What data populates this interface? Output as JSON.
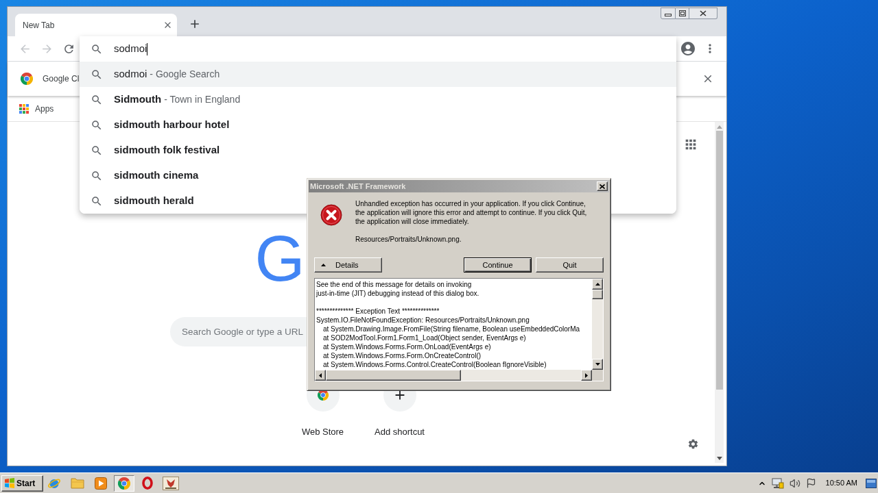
{
  "browser": {
    "tabs": [
      {
        "label": "New Tab",
        "selected": true
      }
    ],
    "nav_buttons": [
      {
        "kind": "back",
        "disabled": true
      },
      {
        "kind": "forward",
        "disabled": true
      },
      {
        "kind": "reload",
        "disabled": false
      }
    ],
    "omnibox": {
      "value": "sodmoi",
      "suggestions": [
        {
          "kind": "typed",
          "text": "sodmoi",
          "detail": "- Google Search",
          "selected": true
        },
        {
          "kind": "entity",
          "text": "Sidmouth",
          "detail": "- Town in England",
          "selected": false
        },
        {
          "kind": "query",
          "text": "sidmouth harbour hotel",
          "selected": false
        },
        {
          "kind": "query",
          "text": "sidmouth folk festival",
          "selected": false
        },
        {
          "kind": "query",
          "text": "sidmouth cinema",
          "selected": false
        },
        {
          "kind": "query",
          "text": "sidmouth herald",
          "selected": false
        }
      ]
    },
    "infobar": {
      "text": "Google Cl"
    },
    "bookmarks": [
      {
        "label": "Apps"
      }
    ],
    "new_tab_page": {
      "logo": "G",
      "search_placeholder": "Search Google or type a URL",
      "shortcuts": [
        {
          "kind": "store",
          "label": "Web Store"
        },
        {
          "kind": "add",
          "label": "Add shortcut"
        }
      ]
    }
  },
  "dialog": {
    "title": "Microsoft .NET Framework",
    "message": "Unhandled exception has occurred in your application. If you click Continue, the application will ignore this error and attempt to continue. If you click Quit, the application will close immediately.",
    "detail": "Resources/Portraits/Unknown.png.",
    "buttons": [
      {
        "kind": "toggle",
        "label": "Details"
      },
      {
        "kind": "default",
        "label": "Continue"
      },
      {
        "kind": "normal",
        "label": "Quit"
      }
    ],
    "details_lines": [
      {
        "kind": "text",
        "text": "See the end of this message for details on invoking"
      },
      {
        "kind": "text",
        "text": "just-in-time (JIT) debugging instead of this dialog box."
      },
      {
        "kind": "heading",
        "text": "************** Exception Text **************"
      },
      {
        "kind": "text",
        "text": "System.IO.FileNotFoundException: Resources/Portraits/Unknown.png"
      },
      {
        "kind": "frame",
        "text": "at System.Drawing.Image.FromFile(String filename, Boolean useEmbeddedColorMa"
      },
      {
        "kind": "frame",
        "text": "at SOD2ModTool.Form1.Form1_Load(Object sender, EventArgs e)"
      },
      {
        "kind": "frame",
        "text": "at System.Windows.Forms.Form.OnLoad(EventArgs e)"
      },
      {
        "kind": "frame",
        "text": "at System.Windows.Forms.Form.OnCreateControl()"
      },
      {
        "kind": "frame",
        "text": "at System.Windows.Forms.Control.CreateControl(Boolean fIgnoreVisible)"
      }
    ]
  },
  "taskbar": {
    "start_label": "Start",
    "apps": [
      {
        "kind": "ie",
        "selected": false
      },
      {
        "kind": "folder",
        "selected": false
      },
      {
        "kind": "media",
        "selected": false
      },
      {
        "kind": "chrome",
        "selected": true
      },
      {
        "kind": "opera",
        "selected": false
      },
      {
        "kind": "app",
        "selected": false
      }
    ],
    "clock": "10:50 AM"
  }
}
